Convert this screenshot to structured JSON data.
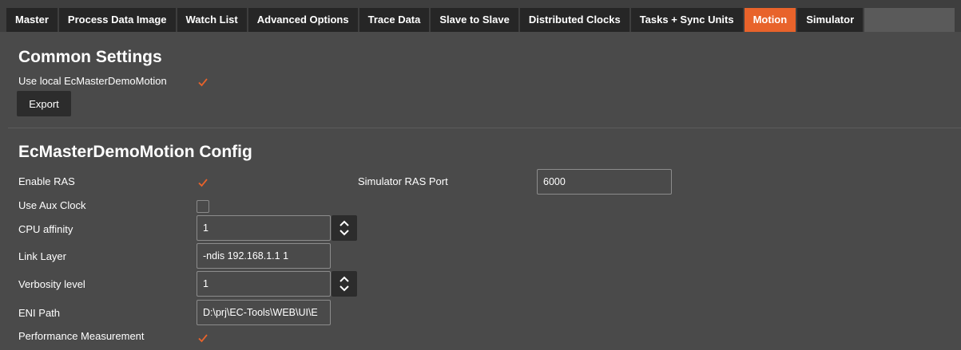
{
  "tabs": [
    {
      "label": "Master",
      "active": false
    },
    {
      "label": "Process Data Image",
      "active": false
    },
    {
      "label": "Watch List",
      "active": false
    },
    {
      "label": "Advanced Options",
      "active": false
    },
    {
      "label": "Trace Data",
      "active": false
    },
    {
      "label": "Slave to Slave",
      "active": false
    },
    {
      "label": "Distributed Clocks",
      "active": false
    },
    {
      "label": "Tasks + Sync Units",
      "active": false
    },
    {
      "label": "Motion",
      "active": true
    },
    {
      "label": "Simulator",
      "active": false
    }
  ],
  "common": {
    "title": "Common Settings",
    "use_local_label": "Use local EcMasterDemoMotion",
    "use_local_checked": true,
    "export_label": "Export"
  },
  "config": {
    "title": "EcMasterDemoMotion Config",
    "enable_ras_label": "Enable RAS",
    "enable_ras_checked": true,
    "sim_ras_port_label": "Simulator RAS Port",
    "sim_ras_port_value": "6000",
    "use_aux_clock_label": "Use Aux Clock",
    "use_aux_clock_checked": false,
    "cpu_affinity_label": "CPU affinity",
    "cpu_affinity_value": "1",
    "link_layer_label": "Link Layer",
    "link_layer_value": "-ndis 192.168.1.1 1",
    "verbosity_label": "Verbosity level",
    "verbosity_value": "1",
    "eni_path_label": "ENI Path",
    "eni_path_value": "D:\\prj\\EC-Tools\\WEB\\UI\\E",
    "perf_label": "Performance Measurement",
    "perf_checked": true
  },
  "colors": {
    "accent": "#e8632b",
    "background": "#4a4a4a",
    "tab_bg": "#262626"
  }
}
